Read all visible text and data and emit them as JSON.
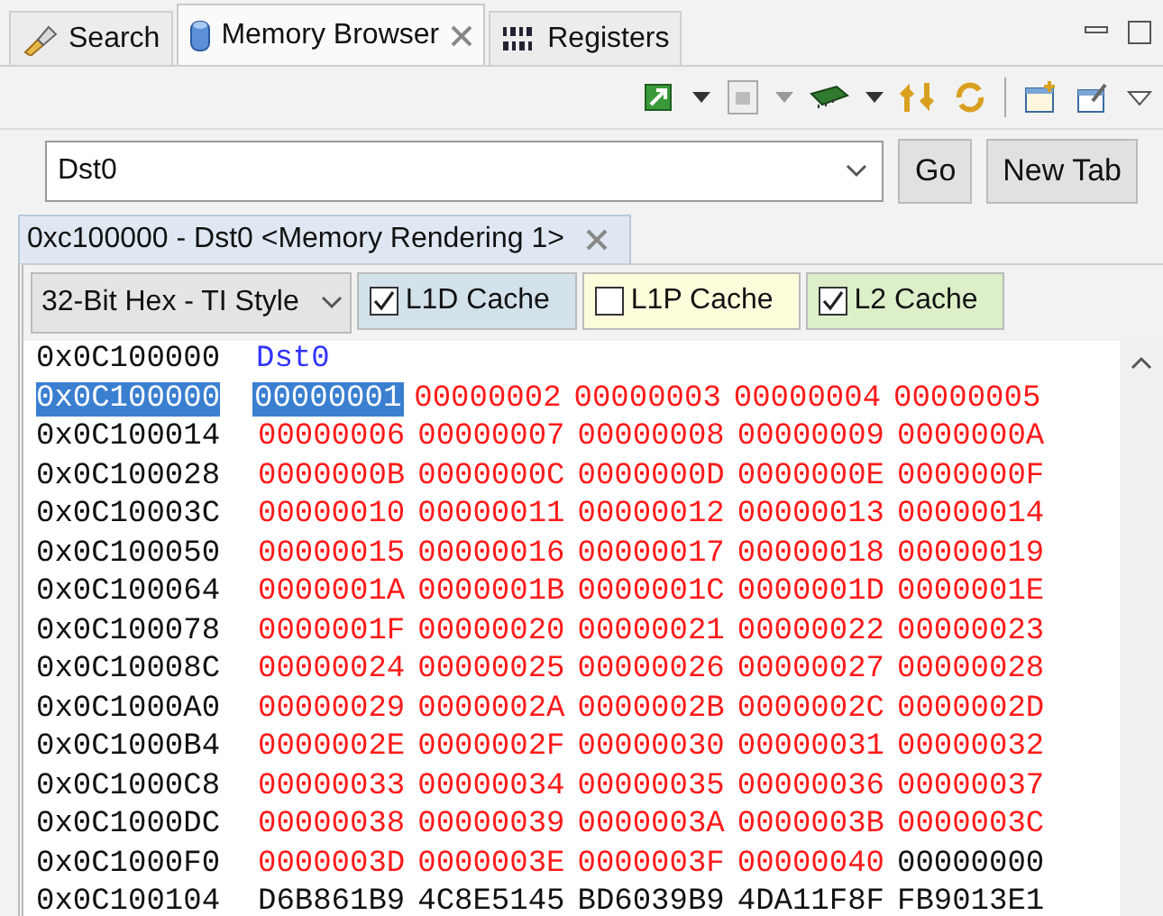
{
  "tabs": [
    {
      "label": "Search",
      "selected": false,
      "closable": false,
      "kind": "search"
    },
    {
      "label": "Memory Browser",
      "selected": true,
      "closable": true,
      "kind": "memory"
    },
    {
      "label": "Registers",
      "selected": false,
      "closable": false,
      "kind": "registers"
    }
  ],
  "address_field": {
    "value": "Dst0"
  },
  "buttons": [
    "Go",
    "New Tab"
  ],
  "rendering_tab": {
    "label": "0xc100000 - Dst0 <Memory Rendering 1>",
    "closable": true
  },
  "format_select": {
    "value": "32-Bit Hex - TI Style"
  },
  "cache_toggles": [
    {
      "label": "L1D Cache",
      "checked": true,
      "color": "#d2e1ea"
    },
    {
      "label": "L1P Cache",
      "checked": false,
      "color": "#fdfddc"
    },
    {
      "label": "L2 Cache",
      "checked": true,
      "color": "#dcefc9"
    }
  ],
  "memory": {
    "label_row": {
      "address": "0x0C100000",
      "label": "Dst0"
    },
    "rows": [
      {
        "address": "0x0C100000",
        "selected": true,
        "cells": [
          {
            "value": "00000001",
            "changed": true,
            "selected": true
          },
          {
            "value": "00000002",
            "changed": true,
            "selected": false
          },
          {
            "value": "00000003",
            "changed": true,
            "selected": false
          },
          {
            "value": "00000004",
            "changed": true,
            "selected": false
          },
          {
            "value": "00000005",
            "changed": true,
            "selected": false
          }
        ]
      },
      {
        "address": "0x0C100014",
        "selected": false,
        "cells": [
          {
            "value": "00000006",
            "changed": true,
            "selected": false
          },
          {
            "value": "00000007",
            "changed": true,
            "selected": false
          },
          {
            "value": "00000008",
            "changed": true,
            "selected": false
          },
          {
            "value": "00000009",
            "changed": true,
            "selected": false
          },
          {
            "value": "0000000A",
            "changed": true,
            "selected": false
          }
        ]
      },
      {
        "address": "0x0C100028",
        "selected": false,
        "cells": [
          {
            "value": "0000000B",
            "changed": true,
            "selected": false
          },
          {
            "value": "0000000C",
            "changed": true,
            "selected": false
          },
          {
            "value": "0000000D",
            "changed": true,
            "selected": false
          },
          {
            "value": "0000000E",
            "changed": true,
            "selected": false
          },
          {
            "value": "0000000F",
            "changed": true,
            "selected": false
          }
        ]
      },
      {
        "address": "0x0C10003C",
        "selected": false,
        "cells": [
          {
            "value": "00000010",
            "changed": true,
            "selected": false
          },
          {
            "value": "00000011",
            "changed": true,
            "selected": false
          },
          {
            "value": "00000012",
            "changed": true,
            "selected": false
          },
          {
            "value": "00000013",
            "changed": true,
            "selected": false
          },
          {
            "value": "00000014",
            "changed": true,
            "selected": false
          }
        ]
      },
      {
        "address": "0x0C100050",
        "selected": false,
        "cells": [
          {
            "value": "00000015",
            "changed": true,
            "selected": false
          },
          {
            "value": "00000016",
            "changed": true,
            "selected": false
          },
          {
            "value": "00000017",
            "changed": true,
            "selected": false
          },
          {
            "value": "00000018",
            "changed": true,
            "selected": false
          },
          {
            "value": "00000019",
            "changed": true,
            "selected": false
          }
        ]
      },
      {
        "address": "0x0C100064",
        "selected": false,
        "cells": [
          {
            "value": "0000001A",
            "changed": true,
            "selected": false
          },
          {
            "value": "0000001B",
            "changed": true,
            "selected": false
          },
          {
            "value": "0000001C",
            "changed": true,
            "selected": false
          },
          {
            "value": "0000001D",
            "changed": true,
            "selected": false
          },
          {
            "value": "0000001E",
            "changed": true,
            "selected": false
          }
        ]
      },
      {
        "address": "0x0C100078",
        "selected": false,
        "cells": [
          {
            "value": "0000001F",
            "changed": true,
            "selected": false
          },
          {
            "value": "00000020",
            "changed": true,
            "selected": false
          },
          {
            "value": "00000021",
            "changed": true,
            "selected": false
          },
          {
            "value": "00000022",
            "changed": true,
            "selected": false
          },
          {
            "value": "00000023",
            "changed": true,
            "selected": false
          }
        ]
      },
      {
        "address": "0x0C10008C",
        "selected": false,
        "cells": [
          {
            "value": "00000024",
            "changed": true,
            "selected": false
          },
          {
            "value": "00000025",
            "changed": true,
            "selected": false
          },
          {
            "value": "00000026",
            "changed": true,
            "selected": false
          },
          {
            "value": "00000027",
            "changed": true,
            "selected": false
          },
          {
            "value": "00000028",
            "changed": true,
            "selected": false
          }
        ]
      },
      {
        "address": "0x0C1000A0",
        "selected": false,
        "cells": [
          {
            "value": "00000029",
            "changed": true,
            "selected": false
          },
          {
            "value": "0000002A",
            "changed": true,
            "selected": false
          },
          {
            "value": "0000002B",
            "changed": true,
            "selected": false
          },
          {
            "value": "0000002C",
            "changed": true,
            "selected": false
          },
          {
            "value": "0000002D",
            "changed": true,
            "selected": false
          }
        ]
      },
      {
        "address": "0x0C1000B4",
        "selected": false,
        "cells": [
          {
            "value": "0000002E",
            "changed": true,
            "selected": false
          },
          {
            "value": "0000002F",
            "changed": true,
            "selected": false
          },
          {
            "value": "00000030",
            "changed": true,
            "selected": false
          },
          {
            "value": "00000031",
            "changed": true,
            "selected": false
          },
          {
            "value": "00000032",
            "changed": true,
            "selected": false
          }
        ]
      },
      {
        "address": "0x0C1000C8",
        "selected": false,
        "cells": [
          {
            "value": "00000033",
            "changed": true,
            "selected": false
          },
          {
            "value": "00000034",
            "changed": true,
            "selected": false
          },
          {
            "value": "00000035",
            "changed": true,
            "selected": false
          },
          {
            "value": "00000036",
            "changed": true,
            "selected": false
          },
          {
            "value": "00000037",
            "changed": true,
            "selected": false
          }
        ]
      },
      {
        "address": "0x0C1000DC",
        "selected": false,
        "cells": [
          {
            "value": "00000038",
            "changed": true,
            "selected": false
          },
          {
            "value": "00000039",
            "changed": true,
            "selected": false
          },
          {
            "value": "0000003A",
            "changed": true,
            "selected": false
          },
          {
            "value": "0000003B",
            "changed": true,
            "selected": false
          },
          {
            "value": "0000003C",
            "changed": true,
            "selected": false
          }
        ]
      },
      {
        "address": "0x0C1000F0",
        "selected": false,
        "cells": [
          {
            "value": "0000003D",
            "changed": true,
            "selected": false
          },
          {
            "value": "0000003E",
            "changed": true,
            "selected": false
          },
          {
            "value": "0000003F",
            "changed": true,
            "selected": false
          },
          {
            "value": "00000040",
            "changed": true,
            "selected": false
          },
          {
            "value": "00000000",
            "changed": false,
            "selected": false
          }
        ]
      },
      {
        "address": "0x0C100104",
        "selected": false,
        "cells": [
          {
            "value": "D6B861B9",
            "changed": false,
            "selected": false
          },
          {
            "value": "4C8E5145",
            "changed": false,
            "selected": false
          },
          {
            "value": "BD6039B9",
            "changed": false,
            "selected": false
          },
          {
            "value": "4DA11F8F",
            "changed": false,
            "selected": false
          },
          {
            "value": "FB9013E1",
            "changed": false,
            "selected": false
          }
        ]
      }
    ]
  }
}
